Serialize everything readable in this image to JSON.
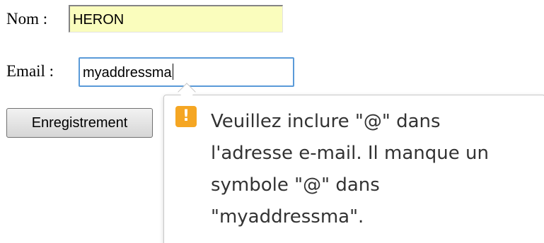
{
  "form": {
    "nom_label": "Nom :",
    "nom_value": "HERON",
    "email_label": "Email :",
    "email_value": "myaddressma",
    "submit_label": "Enregistrement"
  },
  "validation": {
    "icon": "warning-icon",
    "icon_glyph": "!",
    "message": "Veuillez inclure \"@\" dans\nl'adresse e-mail. Il manque un\nsymbole \"@\" dans\n\"myaddressma\"."
  },
  "colors": {
    "autofill_background": "#fafdbd",
    "focus_border": "#5a9ad8",
    "warning": "#f5a623"
  }
}
